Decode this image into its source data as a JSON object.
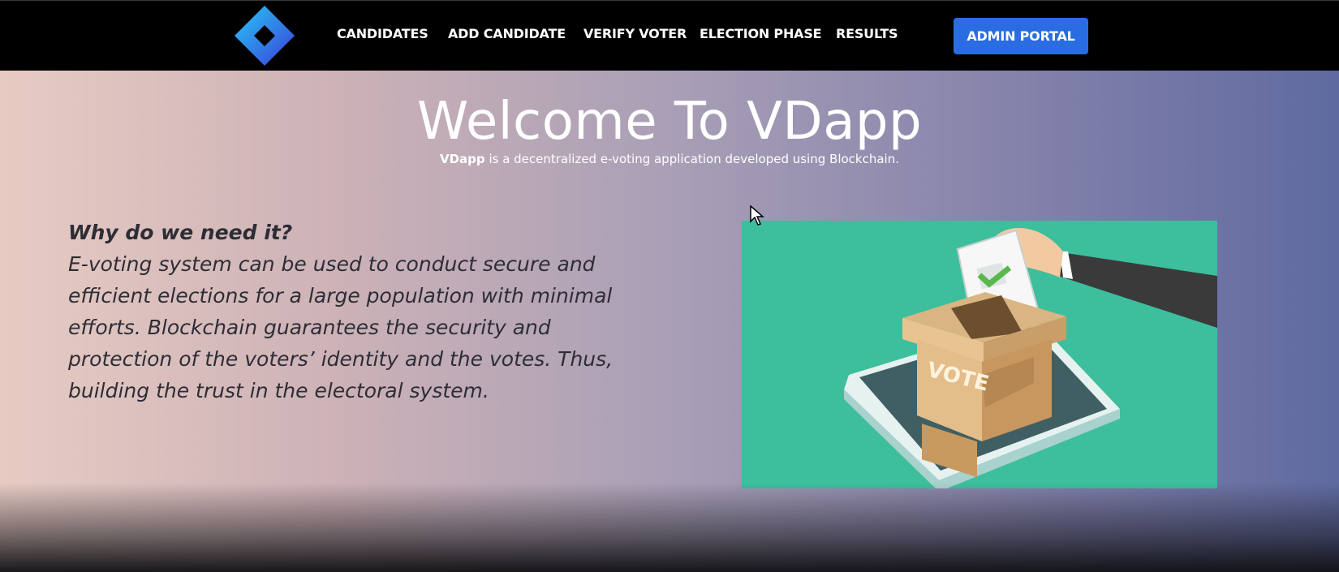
{
  "navbar": {
    "links": [
      {
        "label": "CANDIDATES"
      },
      {
        "label": "ADD CANDIDATE"
      },
      {
        "label": "VERIFY VOTER"
      },
      {
        "label": "ELECTION PHASE"
      },
      {
        "label": "RESULTS"
      }
    ],
    "admin_button": "ADMIN PORTAL",
    "logo_icon": "diamond-logo-icon"
  },
  "hero": {
    "title": "Welcome To VDapp",
    "subtitle_brand": "VDapp",
    "subtitle_rest": " is a decentralized e-voting application developed using Blockchain.",
    "why_heading": "Why do we need it?",
    "why_body": "E-voting system can be used to conduct secure and efficient elections for a large population with minimal efforts. Blockchain guarantees the security and protection of the voters’ identity and the votes. Thus, building the trust in the electoral system.",
    "illustration": {
      "box_label": "VOTE",
      "icon": "ballot-box-illustration"
    }
  },
  "colors": {
    "nav_bg": "#000000",
    "accent": "#2a6de3",
    "illustration_bg": "#3dbe9c"
  }
}
